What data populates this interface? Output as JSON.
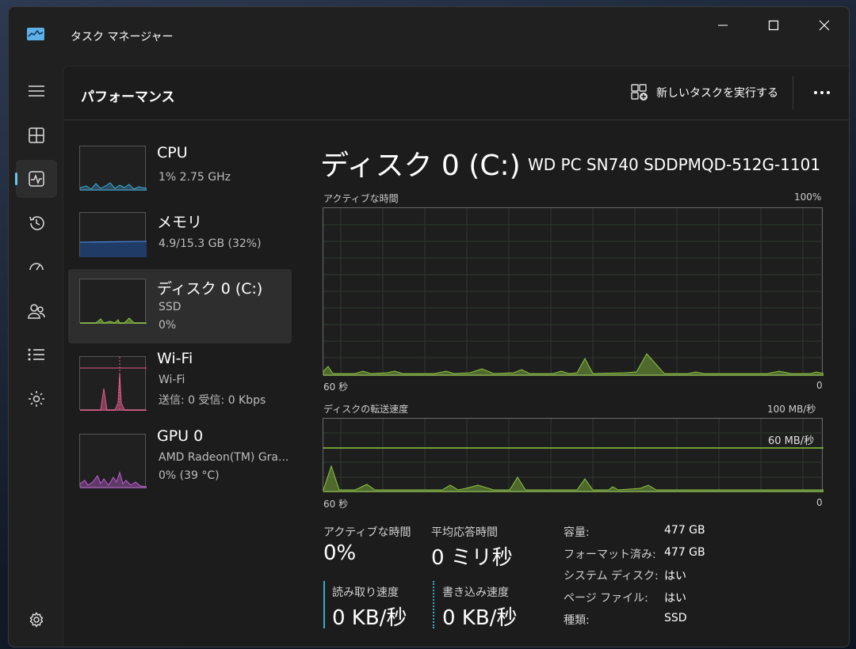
{
  "window": {
    "title": "タスク マネージャー"
  },
  "header": {
    "title": "パフォーマンス",
    "run_task_label": "新しいタスクを実行する"
  },
  "nav": [
    {
      "name": "menu-icon"
    },
    {
      "name": "processes-icon"
    },
    {
      "name": "performance-icon",
      "active": true
    },
    {
      "name": "app-history-icon"
    },
    {
      "name": "startup-apps-icon"
    },
    {
      "name": "users-icon"
    },
    {
      "name": "details-icon"
    },
    {
      "name": "services-icon"
    },
    {
      "name": "settings-icon"
    }
  ],
  "devices": {
    "cpu": {
      "name": "CPU",
      "line1": "1%  2.75 GHz",
      "color": "#3ba9d9"
    },
    "memory": {
      "name": "メモリ",
      "line1": "4.9/15.3 GB (32%)",
      "color": "#4a7fd6"
    },
    "disk": {
      "name": "ディスク 0 (C:)",
      "line1": "SSD",
      "line2": "0%",
      "color": "#8cc63f"
    },
    "wifi": {
      "name": "Wi-Fi",
      "line1": "Wi-Fi",
      "line2": "送信: 0  受信: 0 Kbps",
      "color": "#e05a8a"
    },
    "gpu": {
      "name": "GPU 0",
      "line1": "AMD Radeon(TM) Gra...",
      "line2": "0%  (39 °C)",
      "color": "#c060d8"
    }
  },
  "detail": {
    "title": "ディスク 0 (C:)",
    "model": "WD PC SN740 SDDPMQD-512G-1101",
    "active_graph": {
      "label": "アクティブな時間",
      "max_label": "100%",
      "x_left": "60 秒",
      "x_right": "0"
    },
    "transfer_graph": {
      "label": "ディスクの転送速度",
      "max_label": "100 MB/秒",
      "ref_label": "60 MB/秒",
      "x_left": "60 秒",
      "x_right": "0"
    },
    "stats": {
      "active_time_label": "アクティブな時間",
      "active_time_value": "0%",
      "avg_response_label": "平均応答時間",
      "avg_response_value": "0 ミリ秒",
      "read_label": "読み取り速度",
      "read_value": "0 KB/秒",
      "write_label": "書き込み速度",
      "write_value": "0 KB/秒"
    },
    "props": [
      {
        "key": "容量:",
        "value": "477 GB"
      },
      {
        "key": "フォーマット済み:",
        "value": "477 GB"
      },
      {
        "key": "システム ディスク:",
        "value": "はい"
      },
      {
        "key": "ページ ファイル:",
        "value": "はい"
      },
      {
        "key": "種類:",
        "value": "SSD"
      }
    ]
  },
  "colors": {
    "accent": "#6cc4f0",
    "disk_green": "#8cc63f"
  }
}
